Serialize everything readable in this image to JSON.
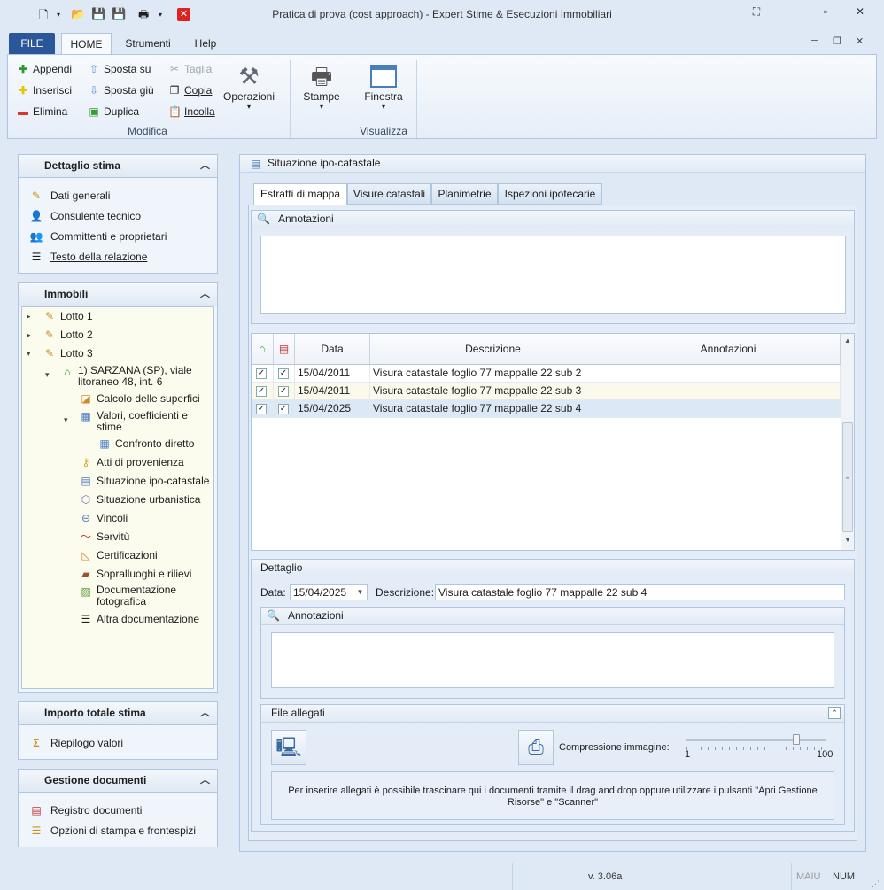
{
  "window": {
    "title": "Pratica di prova (cost approach) - Expert Stime & Esecuzioni Immobiliari"
  },
  "ribbon": {
    "tabs": [
      "FILE",
      "HOME",
      "Strumenti",
      "Help"
    ],
    "modifica": {
      "append": "Appendi",
      "insert": "Inserisci",
      "delete": "Elimina",
      "move_up": "Sposta su",
      "move_down": "Sposta giù",
      "duplicate": "Duplica",
      "cut": "Taglia",
      "copy": "Copia",
      "paste": "Incolla",
      "operations": "Operazioni",
      "group": "Modifica"
    },
    "stampe": "Stampe",
    "visualizza": {
      "window": "Finestra",
      "group": "Visualizza"
    }
  },
  "left": {
    "dettaglio": {
      "title": "Dettaglio stima",
      "items": [
        "Dati generali",
        "Consulente tecnico",
        "Committenti e proprietari",
        "Testo della relazione"
      ]
    },
    "immobili": {
      "title": "Immobili",
      "lotto1": "Lotto 1",
      "lotto2": "Lotto 2",
      "lotto3": "Lotto 3",
      "property": "1) SARZANA (SP), viale litoraneo 48, int. 6",
      "items": [
        "Calcolo delle superfici",
        "Valori, coefficienti e stime",
        "Confronto diretto",
        "Atti di provenienza",
        "Situazione ipo-catastale",
        "Situazione urbanistica",
        "Vincoli",
        "Servitù",
        "Certificazioni",
        "Sopralluoghi e rilievi",
        "Documentazione fotografica",
        "Altra documentazione"
      ]
    },
    "importo": {
      "title": "Importo totale stima",
      "item": "Riepilogo valori"
    },
    "gestione": {
      "title": "Gestione documenti",
      "items": [
        "Registro documenti",
        "Opzioni di stampa e frontespizi"
      ]
    }
  },
  "main": {
    "title": "Situazione ipo-catastale",
    "tabs": [
      "Estratti di mappa",
      "Visure catastali",
      "Planimetrie",
      "Ispezioni ipotecarie"
    ],
    "annotazioni_label": "Annotazioni",
    "grid": {
      "headers": {
        "data": "Data",
        "descrizione": "Descrizione",
        "annotazioni": "Annotazioni"
      },
      "rows": [
        {
          "data": "15/04/2011",
          "descrizione": "Visura catastale foglio 77 mappalle 22 sub 2",
          "annotazioni": ""
        },
        {
          "data": "15/04/2011",
          "descrizione": "Visura catastale foglio 77 mappalle 22 sub 3",
          "annotazioni": ""
        },
        {
          "data": "15/04/2025",
          "descrizione": "Visura catastale foglio 77 mappalle 22 sub 4",
          "annotazioni": ""
        }
      ]
    },
    "dettaglio": {
      "title": "Dettaglio",
      "data_label": "Data:",
      "data_value": "15/04/2025",
      "desc_label": "Descrizione:",
      "desc_value": "Visura catastale foglio 77 mappalle 22 sub 4",
      "annotazioni_label": "Annotazioni"
    },
    "allegati": {
      "title": "File allegati",
      "compression_label": "Compressione immagine:",
      "slider_min": "1",
      "slider_max": "100",
      "slider_value": 80,
      "hint": "Per inserire allegati è possibile trascinare qui i documenti tramite il drag and drop oppure utilizzare i pulsanti \"Apri Gestione Risorse\" e \"Scanner\""
    }
  },
  "status": {
    "version": "v. 3.06a",
    "caps": "MAIU",
    "num": "NUM"
  }
}
